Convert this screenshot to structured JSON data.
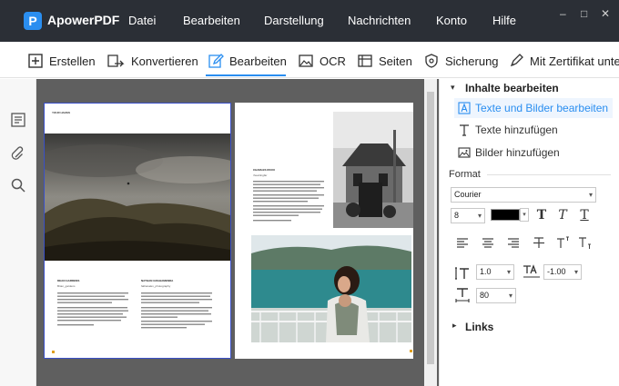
{
  "app": {
    "name": "ApowerPDF",
    "logo_letter": "P"
  },
  "menu": [
    "Datei",
    "Bearbeiten",
    "Darstellung",
    "Nachrichten",
    "Konto",
    "Hilfe"
  ],
  "window": {
    "minimize": "–",
    "maximize": "□",
    "close": "✕"
  },
  "toolbar": {
    "create": "Erstellen",
    "convert": "Konvertieren",
    "edit": "Bearbeiten",
    "ocr": "OCR",
    "pages": "Seiten",
    "security": "Sicherung",
    "certificate": "Mit Zertifikat unte"
  },
  "document": {
    "page1_header": "YOUR HAVEN",
    "page1_col1_title": "DEAN GARDENS",
    "page1_col1_sub": "Brian_gardens",
    "page1_col2_title": "NATHAN GRAHAMENDA",
    "page1_col2_sub": "fathanalex_photography",
    "page2_title": "CHARLES ROUX",
    "page2_sub": "rheartingfar"
  },
  "panel": {
    "section_title": "Inhalte bearbeiten",
    "options": [
      "Texte und Bilder bearbeiten",
      "Texte hinzufügen",
      "Bilder hinzufügen"
    ],
    "format_label": "Format",
    "font": "Courier",
    "font_size": "8",
    "line_spacing": "1.0",
    "char_spacing": "-1.00",
    "scale": "80",
    "links_label": "Links"
  }
}
